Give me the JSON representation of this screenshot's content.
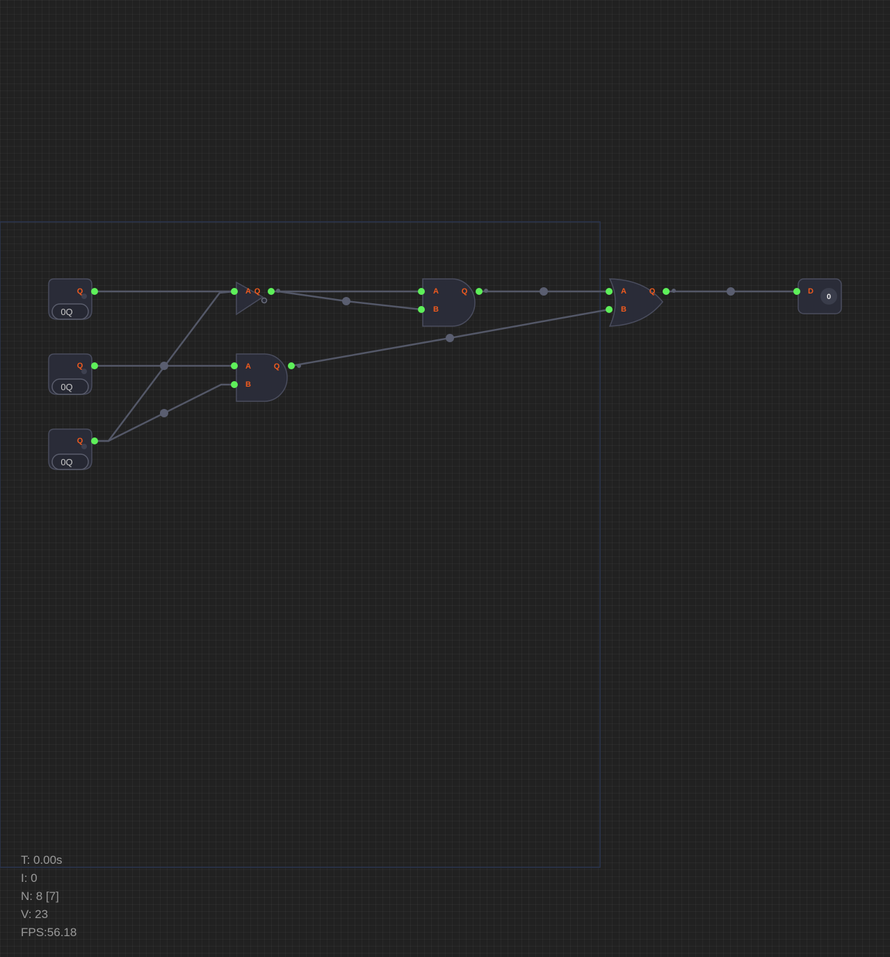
{
  "colors": {
    "background": "#212121",
    "node_fill": "#2a2c38",
    "node_stroke": "#4a4d5e",
    "wire": "#545868",
    "pin_active": "#5ef05a",
    "pin_label": "#f05a1e",
    "selection_border": "#2b3550"
  },
  "inputs": [
    {
      "output_label": "Q",
      "toggle_label": "0Q"
    },
    {
      "output_label": "Q",
      "toggle_label": "0Q"
    },
    {
      "output_label": "Q",
      "toggle_label": "0Q"
    }
  ],
  "gates": {
    "not_gate": {
      "type": "NOT",
      "input_label": "A",
      "output_label": "Q"
    },
    "and_gate_top": {
      "type": "AND",
      "input_a_label": "A",
      "input_b_label": "B",
      "output_label": "Q"
    },
    "and_gate_bottom": {
      "type": "AND",
      "input_a_label": "A",
      "input_b_label": "B",
      "output_label": "Q"
    },
    "or_gate": {
      "type": "OR",
      "input_a_label": "A",
      "input_b_label": "B",
      "output_label": "Q"
    }
  },
  "output_display": {
    "input_label": "D",
    "value": "0"
  },
  "stats": {
    "time": "T: 0.00s",
    "iterations": "I: 0",
    "nodes": "N: 8 [7]",
    "vertices": "V: 23",
    "fps": "FPS:56.18"
  }
}
